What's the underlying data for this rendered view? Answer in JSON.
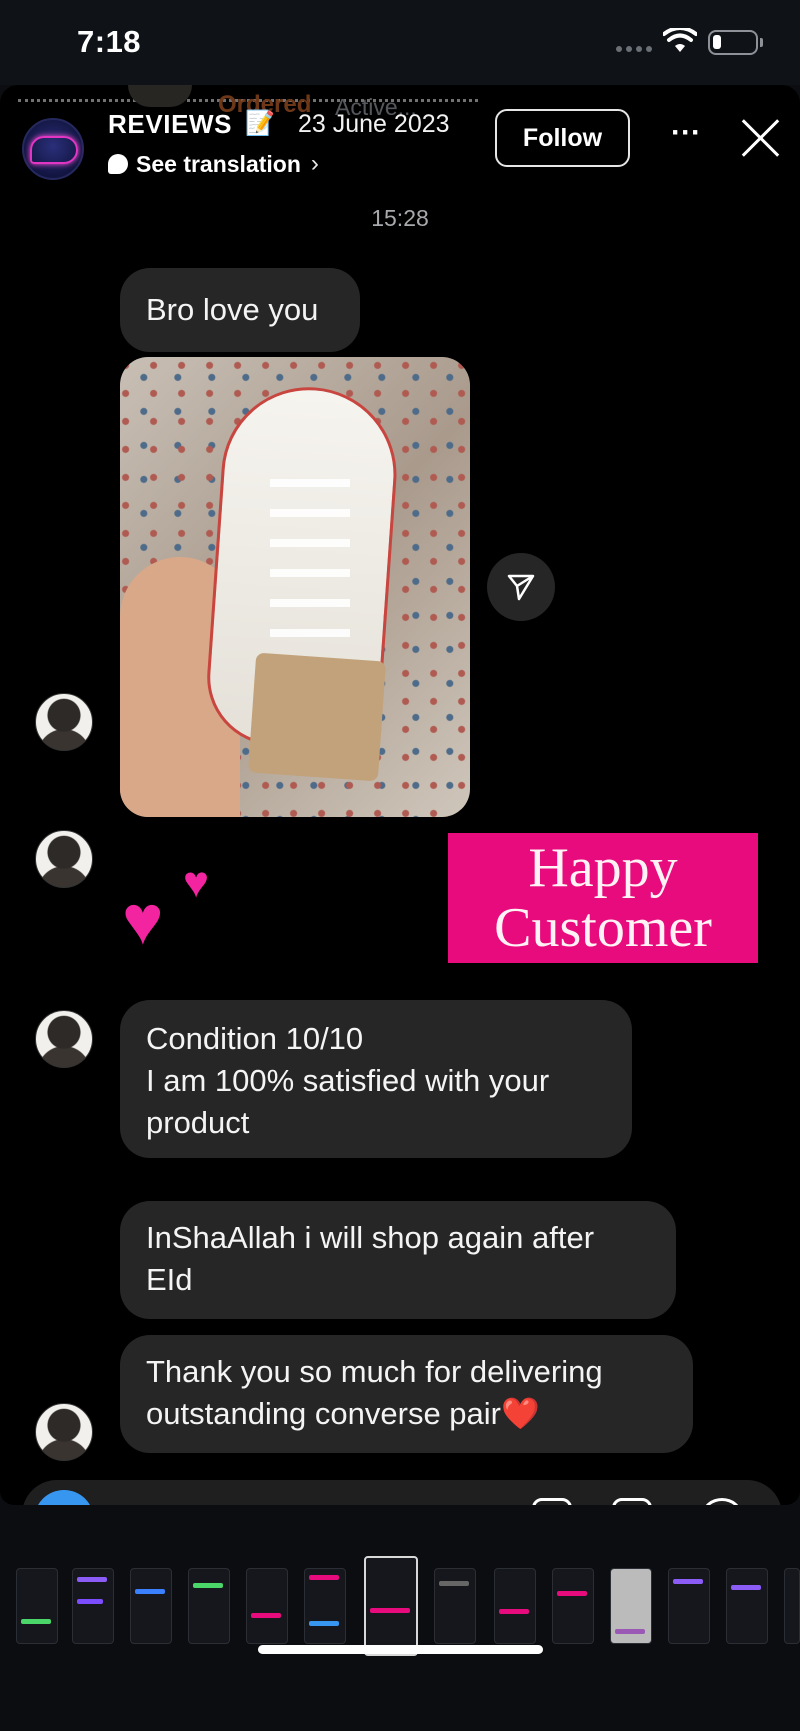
{
  "status_bar": {
    "time": "7:18",
    "battery_level": 0.2
  },
  "ghost_header": {
    "ordered": "Ordered",
    "active": "Active..."
  },
  "story": {
    "title": "REVIEWS",
    "memo_emoji": "📝",
    "date": "23 June 2023",
    "translate_label": "See translation",
    "follow_label": "Follow",
    "more_label": "···"
  },
  "chat": {
    "timestamp": "15:28",
    "messages": [
      {
        "text": "Bro love you"
      },
      {
        "lines": [
          "Condition 10/10",
          "I am 100% satisfied with your",
          "product"
        ]
      },
      {
        "lines": [
          "InShaAllah i will shop again after",
          "EId"
        ]
      },
      {
        "lines": [
          "Thank you so much for delivering",
          "outstanding converse pair❤️"
        ]
      }
    ],
    "sticker": {
      "line1": "Happy",
      "line2": "Customer"
    },
    "hearts": "💕"
  },
  "colors": {
    "accent_pink": "#e80b7d",
    "ordered_orange": "#c9672d",
    "bubble_gray": "#262626",
    "camera_blue": "#3797f0"
  },
  "icons": [
    "wifi-icon",
    "battery-icon",
    "close-icon",
    "more-icon",
    "share-icon",
    "camera-icon",
    "chevron-right-icon"
  ]
}
